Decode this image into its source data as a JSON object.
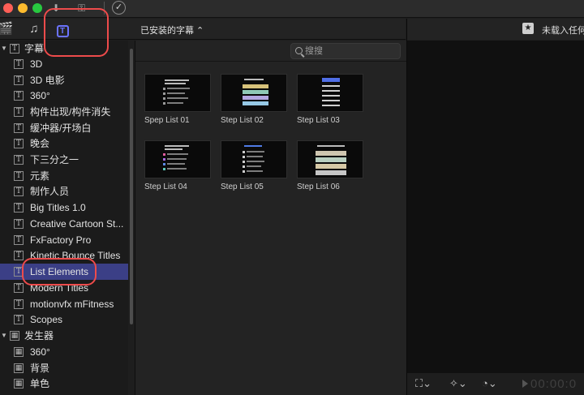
{
  "browser": {
    "installed_dropdown": "已安装的字幕 ⌃",
    "search_placeholder": "搜搜"
  },
  "sidebar": {
    "categories": [
      {
        "label": "字幕",
        "expanded": true
      },
      {
        "label": "发生器",
        "expanded": true
      }
    ],
    "title_items": [
      "3D",
      "3D 电影",
      "360°",
      "构件出现/构件消失",
      "缓冲器/开场白",
      "晚会",
      "下三分之一",
      "元素",
      "制作人员",
      "Big Titles 1.0",
      "Creative Cartoon St...",
      "FxFactory Pro",
      "Kinetic Bounce Titles",
      "List Elements",
      "Modern Titles",
      "motionvfx mFitness",
      "Scopes"
    ],
    "selected_item": "List Elements",
    "generator_items": [
      "360°",
      "背景",
      "单色"
    ]
  },
  "grid": {
    "items": [
      {
        "label": "Spep List 01"
      },
      {
        "label": "Step List 02"
      },
      {
        "label": "Step List 03"
      },
      {
        "label": "Step List 04"
      },
      {
        "label": "Step List 05"
      },
      {
        "label": "Step List 06"
      }
    ]
  },
  "viewer": {
    "status": "未载入任何",
    "timecode": "00:00:0"
  },
  "colors": {
    "selection": "#3b3f86",
    "accent": "#6b73ff",
    "highlight": "#ee4b4b"
  }
}
